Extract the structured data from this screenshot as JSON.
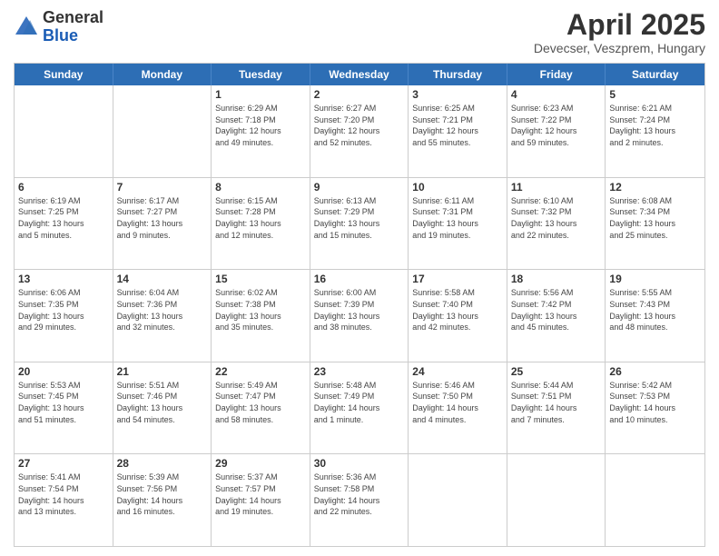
{
  "logo": {
    "general": "General",
    "blue": "Blue"
  },
  "header": {
    "title": "April 2025",
    "subtitle": "Devecser, Veszprem, Hungary"
  },
  "weekdays": [
    "Sunday",
    "Monday",
    "Tuesday",
    "Wednesday",
    "Thursday",
    "Friday",
    "Saturday"
  ],
  "weeks": [
    [
      {
        "day": "",
        "info": ""
      },
      {
        "day": "",
        "info": ""
      },
      {
        "day": "1",
        "info": "Sunrise: 6:29 AM\nSunset: 7:18 PM\nDaylight: 12 hours\nand 49 minutes."
      },
      {
        "day": "2",
        "info": "Sunrise: 6:27 AM\nSunset: 7:20 PM\nDaylight: 12 hours\nand 52 minutes."
      },
      {
        "day": "3",
        "info": "Sunrise: 6:25 AM\nSunset: 7:21 PM\nDaylight: 12 hours\nand 55 minutes."
      },
      {
        "day": "4",
        "info": "Sunrise: 6:23 AM\nSunset: 7:22 PM\nDaylight: 12 hours\nand 59 minutes."
      },
      {
        "day": "5",
        "info": "Sunrise: 6:21 AM\nSunset: 7:24 PM\nDaylight: 13 hours\nand 2 minutes."
      }
    ],
    [
      {
        "day": "6",
        "info": "Sunrise: 6:19 AM\nSunset: 7:25 PM\nDaylight: 13 hours\nand 5 minutes."
      },
      {
        "day": "7",
        "info": "Sunrise: 6:17 AM\nSunset: 7:27 PM\nDaylight: 13 hours\nand 9 minutes."
      },
      {
        "day": "8",
        "info": "Sunrise: 6:15 AM\nSunset: 7:28 PM\nDaylight: 13 hours\nand 12 minutes."
      },
      {
        "day": "9",
        "info": "Sunrise: 6:13 AM\nSunset: 7:29 PM\nDaylight: 13 hours\nand 15 minutes."
      },
      {
        "day": "10",
        "info": "Sunrise: 6:11 AM\nSunset: 7:31 PM\nDaylight: 13 hours\nand 19 minutes."
      },
      {
        "day": "11",
        "info": "Sunrise: 6:10 AM\nSunset: 7:32 PM\nDaylight: 13 hours\nand 22 minutes."
      },
      {
        "day": "12",
        "info": "Sunrise: 6:08 AM\nSunset: 7:34 PM\nDaylight: 13 hours\nand 25 minutes."
      }
    ],
    [
      {
        "day": "13",
        "info": "Sunrise: 6:06 AM\nSunset: 7:35 PM\nDaylight: 13 hours\nand 29 minutes."
      },
      {
        "day": "14",
        "info": "Sunrise: 6:04 AM\nSunset: 7:36 PM\nDaylight: 13 hours\nand 32 minutes."
      },
      {
        "day": "15",
        "info": "Sunrise: 6:02 AM\nSunset: 7:38 PM\nDaylight: 13 hours\nand 35 minutes."
      },
      {
        "day": "16",
        "info": "Sunrise: 6:00 AM\nSunset: 7:39 PM\nDaylight: 13 hours\nand 38 minutes."
      },
      {
        "day": "17",
        "info": "Sunrise: 5:58 AM\nSunset: 7:40 PM\nDaylight: 13 hours\nand 42 minutes."
      },
      {
        "day": "18",
        "info": "Sunrise: 5:56 AM\nSunset: 7:42 PM\nDaylight: 13 hours\nand 45 minutes."
      },
      {
        "day": "19",
        "info": "Sunrise: 5:55 AM\nSunset: 7:43 PM\nDaylight: 13 hours\nand 48 minutes."
      }
    ],
    [
      {
        "day": "20",
        "info": "Sunrise: 5:53 AM\nSunset: 7:45 PM\nDaylight: 13 hours\nand 51 minutes."
      },
      {
        "day": "21",
        "info": "Sunrise: 5:51 AM\nSunset: 7:46 PM\nDaylight: 13 hours\nand 54 minutes."
      },
      {
        "day": "22",
        "info": "Sunrise: 5:49 AM\nSunset: 7:47 PM\nDaylight: 13 hours\nand 58 minutes."
      },
      {
        "day": "23",
        "info": "Sunrise: 5:48 AM\nSunset: 7:49 PM\nDaylight: 14 hours\nand 1 minute."
      },
      {
        "day": "24",
        "info": "Sunrise: 5:46 AM\nSunset: 7:50 PM\nDaylight: 14 hours\nand 4 minutes."
      },
      {
        "day": "25",
        "info": "Sunrise: 5:44 AM\nSunset: 7:51 PM\nDaylight: 14 hours\nand 7 minutes."
      },
      {
        "day": "26",
        "info": "Sunrise: 5:42 AM\nSunset: 7:53 PM\nDaylight: 14 hours\nand 10 minutes."
      }
    ],
    [
      {
        "day": "27",
        "info": "Sunrise: 5:41 AM\nSunset: 7:54 PM\nDaylight: 14 hours\nand 13 minutes."
      },
      {
        "day": "28",
        "info": "Sunrise: 5:39 AM\nSunset: 7:56 PM\nDaylight: 14 hours\nand 16 minutes."
      },
      {
        "day": "29",
        "info": "Sunrise: 5:37 AM\nSunset: 7:57 PM\nDaylight: 14 hours\nand 19 minutes."
      },
      {
        "day": "30",
        "info": "Sunrise: 5:36 AM\nSunset: 7:58 PM\nDaylight: 14 hours\nand 22 minutes."
      },
      {
        "day": "",
        "info": ""
      },
      {
        "day": "",
        "info": ""
      },
      {
        "day": "",
        "info": ""
      }
    ]
  ]
}
